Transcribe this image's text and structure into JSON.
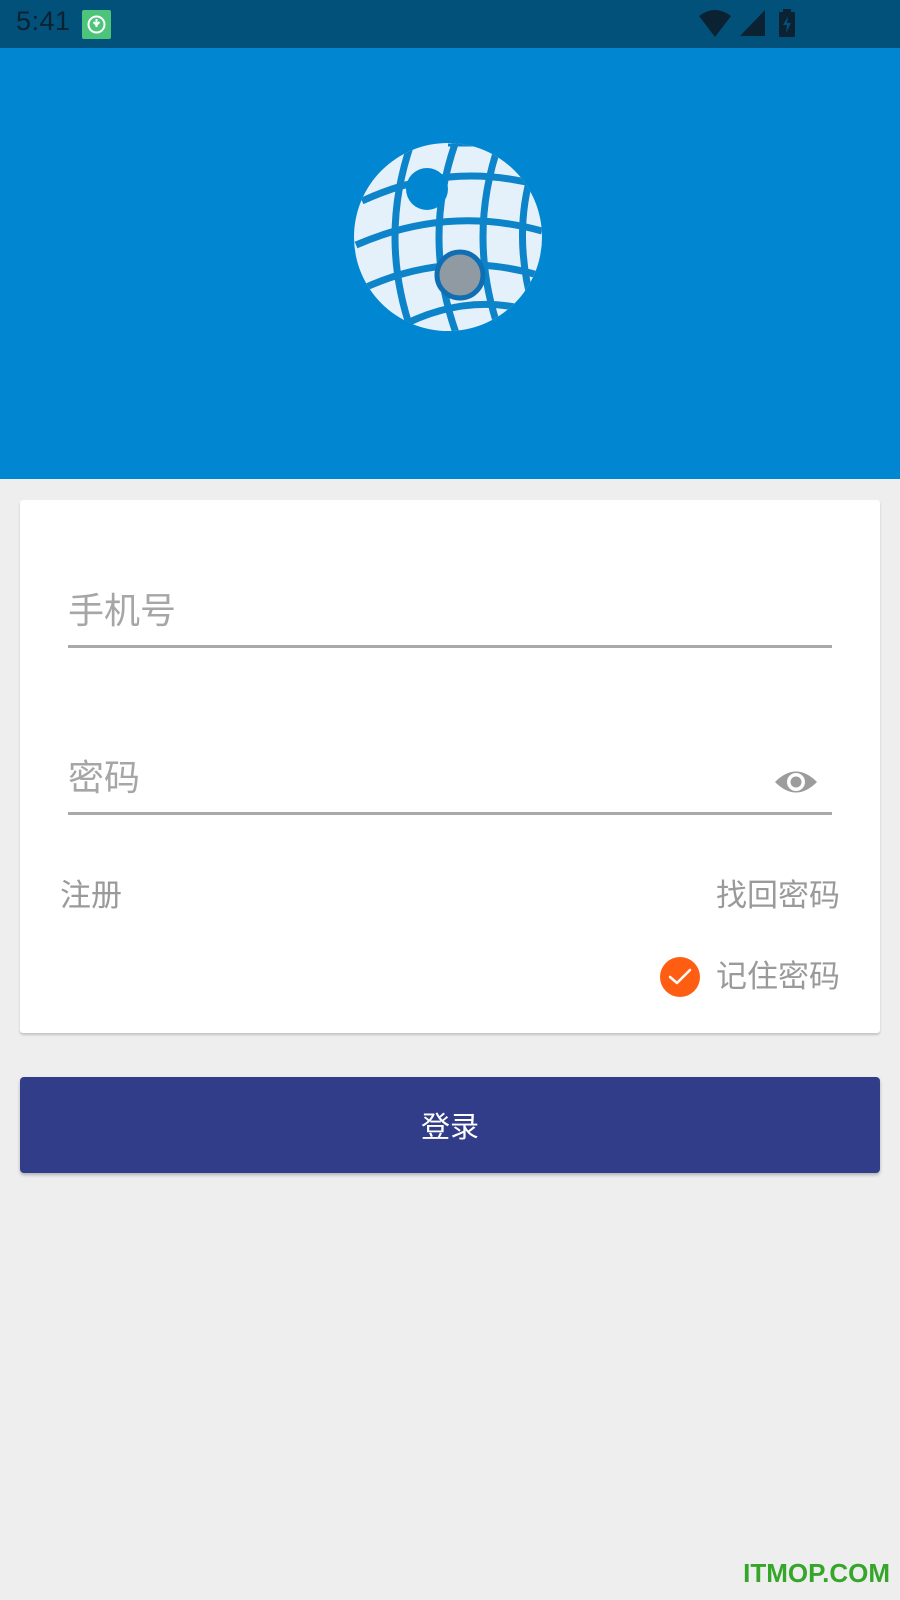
{
  "status_bar": {
    "time": "5:41",
    "icons": [
      "notification-app-icon",
      "wifi-icon",
      "cell-signal-icon",
      "battery-charging-icon"
    ]
  },
  "header": {
    "logo_icon": "globe-logo-icon",
    "background_color": "#0187d2"
  },
  "login_form": {
    "phone_placeholder": "手机号",
    "password_placeholder": "密码",
    "password_toggle_icon": "eye-icon",
    "register_link": "注册",
    "forgot_password_link": "找回密码",
    "remember_password": {
      "label": "记住密码",
      "checked": true,
      "color": "#ff5d12"
    },
    "login_button": "登录",
    "login_button_color": "#313d89"
  },
  "watermark": "ITMOP.COM"
}
